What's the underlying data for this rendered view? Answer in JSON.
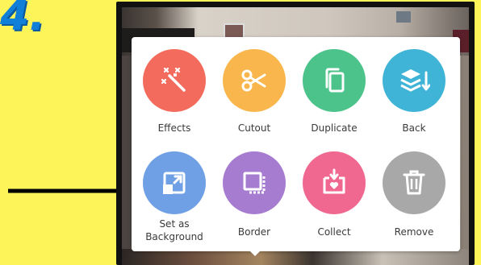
{
  "step_number": "4.",
  "menu": {
    "row1": [
      {
        "label": "Effects",
        "icon": "magic-wand-icon",
        "color": "#f36b5c"
      },
      {
        "label": "Cutout",
        "icon": "scissors-icon",
        "color": "#f8b64c"
      },
      {
        "label": "Duplicate",
        "icon": "duplicate-icon",
        "color": "#4cc38a"
      },
      {
        "label": "Back",
        "icon": "layers-back-icon",
        "color": "#3fb4d6"
      }
    ],
    "row2": [
      {
        "label_line1": "Set as",
        "label_line2": "Background",
        "icon": "set-background-icon",
        "color": "#6fa0e6"
      },
      {
        "label": "Border",
        "icon": "border-icon",
        "color": "#a67cd1"
      },
      {
        "label": "Collect",
        "icon": "collect-icon",
        "color": "#f06790"
      },
      {
        "label": "Remove",
        "icon": "trash-icon",
        "color": "#a8a8a8"
      }
    ]
  },
  "colors": {
    "page_background": "#fdf45a",
    "step_number": "#0f7fd8",
    "arrow": "#000000"
  }
}
